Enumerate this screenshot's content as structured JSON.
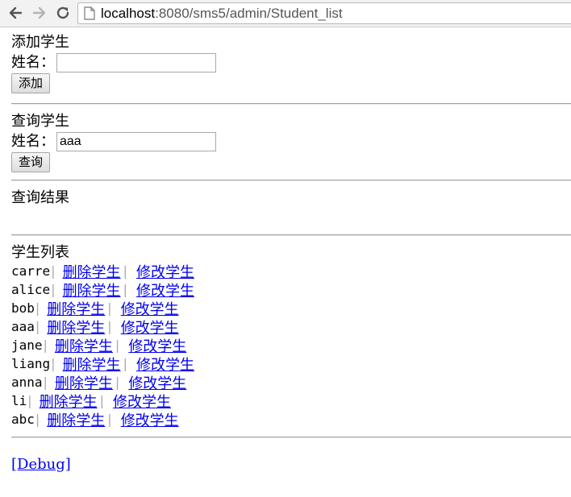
{
  "browser": {
    "url_host": "localhost",
    "url_path": ":8080/sms5/admin/Student_list"
  },
  "add_section": {
    "title": "添加学生",
    "name_label": "姓名：",
    "name_value": "",
    "button_label": "添加"
  },
  "query_section": {
    "title": "查询学生",
    "name_label": "姓名：",
    "name_value": "aaa",
    "button_label": "查询"
  },
  "result_section": {
    "title": "查询结果"
  },
  "list_section": {
    "title": "学生列表",
    "separator": "|",
    "delete_label": "删除学生",
    "edit_label": "修改学生",
    "students": [
      {
        "name": "carre"
      },
      {
        "name": "alice"
      },
      {
        "name": "bob"
      },
      {
        "name": "aaa"
      },
      {
        "name": "jane"
      },
      {
        "name": "liang"
      },
      {
        "name": "anna"
      },
      {
        "name": "li"
      },
      {
        "name": "abc"
      }
    ]
  },
  "debug_link": "[Debug]"
}
